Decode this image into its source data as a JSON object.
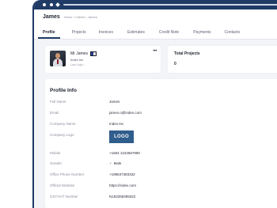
{
  "header": {
    "title": "James",
    "breadcrumb": "Home • Clients • James"
  },
  "tabs": [
    {
      "label": "Profile",
      "active": true
    },
    {
      "label": "Projects",
      "active": false
    },
    {
      "label": "Invoices",
      "active": false
    },
    {
      "label": "Estimates",
      "active": false
    },
    {
      "label": "Credit Note",
      "active": false
    },
    {
      "label": "Payments",
      "active": false
    },
    {
      "label": "Contacts",
      "active": false
    }
  ],
  "user_card": {
    "name": "Mr James",
    "company": "Index Inc",
    "last_login": "Last Login --",
    "menu_icon": "more-horizontal-icon"
  },
  "stats_card": {
    "title": "Total Projects",
    "value": "0"
  },
  "profile_info": {
    "title": "Profile Info",
    "rows": [
      {
        "label": "Full Name",
        "value": "James"
      },
      {
        "label": "Email",
        "value": "james.o@index.com"
      },
      {
        "label": "Company Name",
        "value": "Index Inc"
      },
      {
        "label": "Company Logo",
        "value": "LOGO"
      },
      {
        "label": "Mobile",
        "value": "+1664 1234567890"
      },
      {
        "label": "Gender",
        "value": "Male"
      },
      {
        "label": "Office Phone Number",
        "value": "+198637383332"
      },
      {
        "label": "Official Website",
        "value": "https://index.com"
      },
      {
        "label": "GST/VAT Number",
        "value": "N183268399322"
      }
    ]
  },
  "colors": {
    "brand": "#1f3b66",
    "logo_bg": "#2f5d8c",
    "page_bg": "#f2f4f7"
  }
}
